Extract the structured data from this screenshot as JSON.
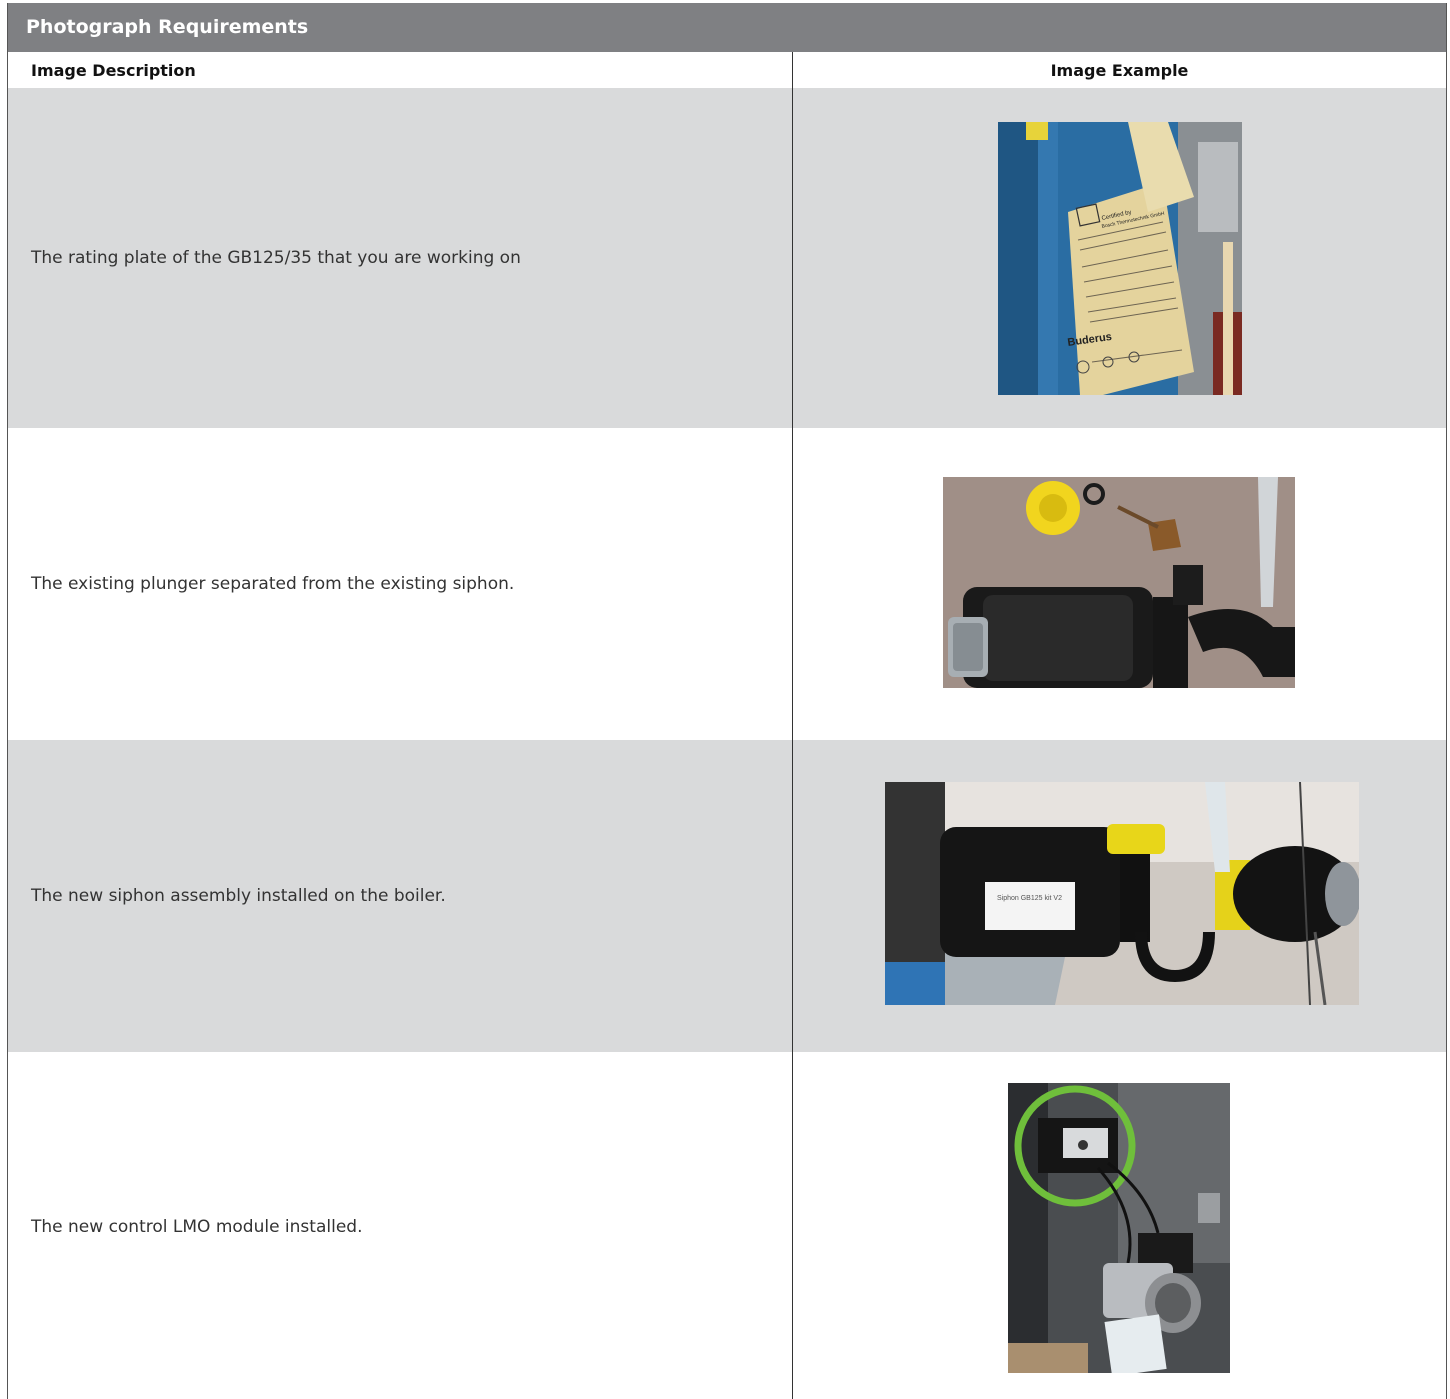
{
  "title": "Photograph Requirements",
  "headers": {
    "description": "Image Description",
    "example": "Image Example"
  },
  "rows": [
    {
      "description": "The rating plate of the GB125/35 that you are working on",
      "photo_icon": "rating-plate-photo",
      "plate": {
        "certified": "Certified by",
        "company": "Bosch Thermotechnik GmbH",
        "brand": "Buderus"
      }
    },
    {
      "description": "The existing plunger separated from the existing siphon.",
      "photo_icon": "plunger-siphon-photo"
    },
    {
      "description": "The new siphon assembly installed on the boiler.",
      "photo_icon": "siphon-assembly-photo",
      "label": "Siphon GB125 kit V2"
    },
    {
      "description": "The new control LMO module installed.",
      "photo_icon": "lmo-module-photo"
    }
  ],
  "colors": {
    "title_bar": "#7f8083",
    "shaded_row": "#d9dadb",
    "highlight_circle": "#6fbf3b"
  }
}
